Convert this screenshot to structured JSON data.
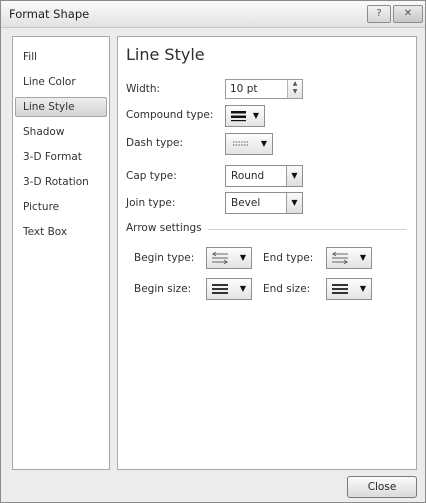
{
  "dialog": {
    "title": "Format Shape",
    "help_label": "?",
    "close_x_label": "✕",
    "close_button_label": "Close"
  },
  "sidebar": {
    "items": [
      {
        "label": "Fill",
        "selected": false
      },
      {
        "label": "Line Color",
        "selected": false
      },
      {
        "label": "Line Style",
        "selected": true
      },
      {
        "label": "Shadow",
        "selected": false
      },
      {
        "label": "3-D Format",
        "selected": false
      },
      {
        "label": "3-D Rotation",
        "selected": false
      },
      {
        "label": "Picture",
        "selected": false
      },
      {
        "label": "Text Box",
        "selected": false
      }
    ]
  },
  "panel": {
    "heading": "Line Style",
    "width": {
      "label": "Width:",
      "value": "10 pt"
    },
    "compound_type": {
      "label": "Compound type:"
    },
    "dash_type": {
      "label": "Dash type:"
    },
    "cap_type": {
      "label": "Cap type:",
      "value": "Round"
    },
    "join_type": {
      "label": "Join type:",
      "value": "Bevel"
    },
    "arrow_settings": {
      "label": "Arrow settings",
      "begin_type": {
        "label": "Begin type:"
      },
      "end_type": {
        "label": "End type:"
      },
      "begin_size": {
        "label": "Begin size:"
      },
      "end_size": {
        "label": "End size:"
      }
    }
  },
  "icons": {
    "dropdown_caret": "▼",
    "spin_up": "▲",
    "spin_down": "▼"
  }
}
